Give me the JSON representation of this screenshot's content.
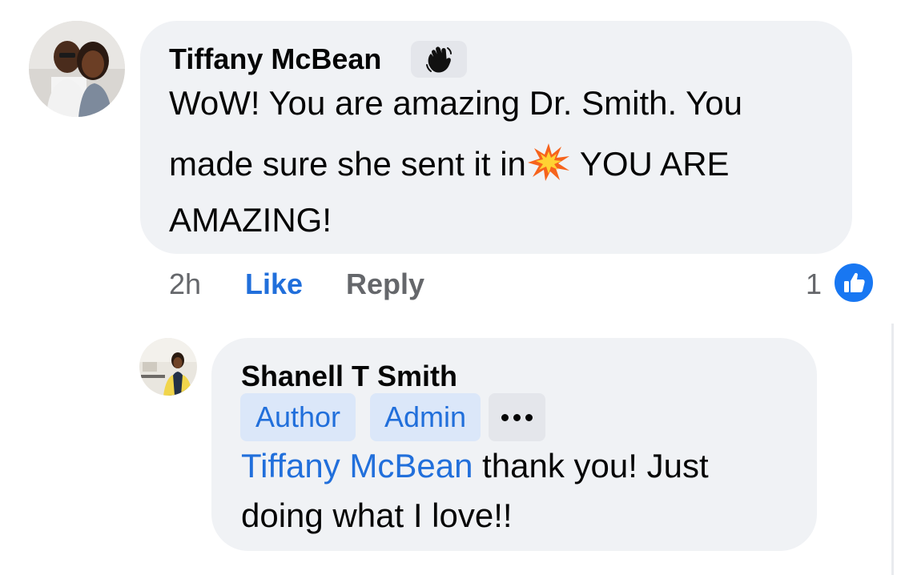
{
  "comment": {
    "author": "Tiffany McBean",
    "author_icon": "waving-hand-icon",
    "text_line1": "WoW! You are amazing Dr. Smith. You",
    "text_line2_a": "made sure she sent it in",
    "text_line2_emoji": "collision-icon",
    "text_line2_b": " YOU ARE",
    "text_line3": "AMAZING!",
    "time": "2h",
    "like_label": "Like",
    "reply_label": "Reply",
    "reaction_count": "1",
    "reaction_icon": "thumbs-up-icon"
  },
  "reply": {
    "author": "Shanell T Smith",
    "badges": [
      "Author",
      "Admin"
    ],
    "more_icon": "more-dots-icon",
    "mention": "Tiffany McBean",
    "text_after_mention": " thank you! Just",
    "text_line2": "doing what I love!!"
  },
  "colors": {
    "link_blue": "#216fdb",
    "bubble_gray": "#f0f2f5",
    "like_blue": "#1877f2",
    "badge_bg": "#dbe7f9"
  }
}
